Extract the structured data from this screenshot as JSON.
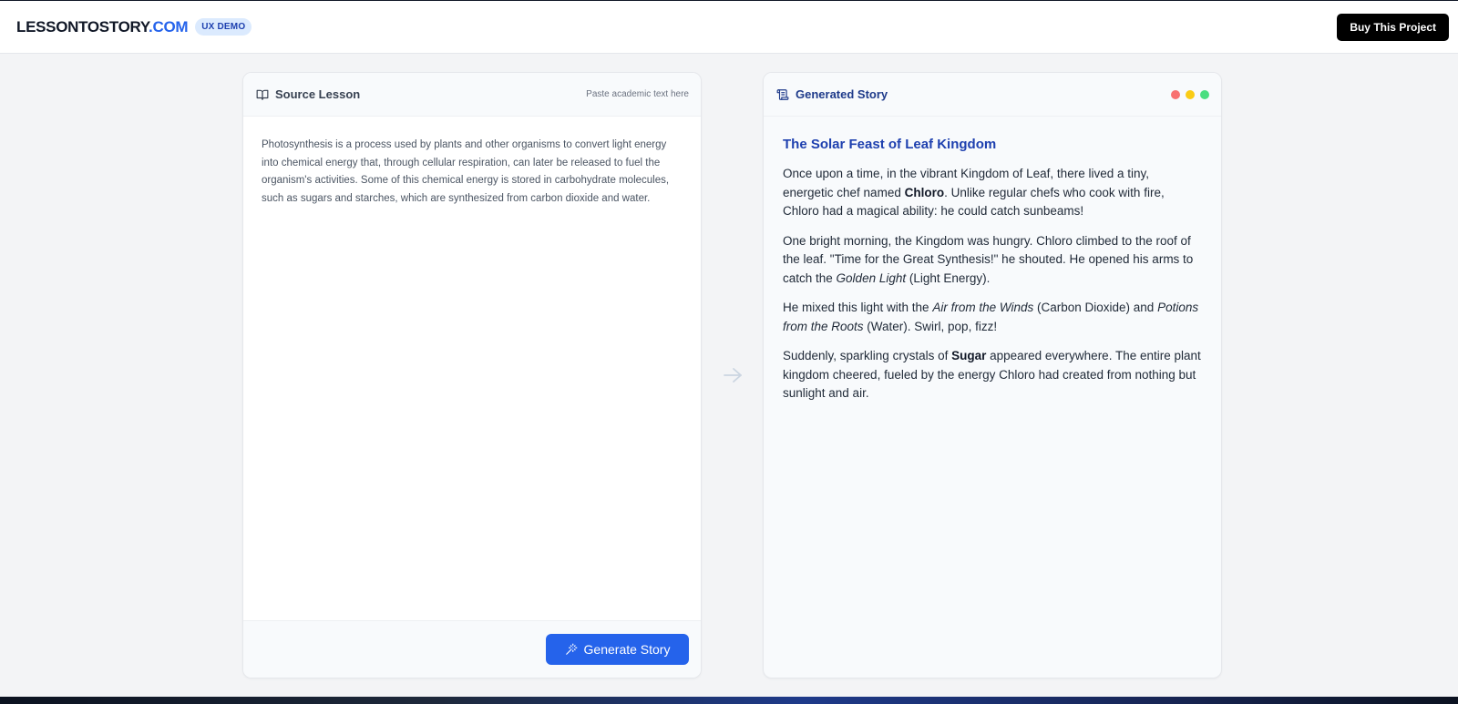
{
  "navbar": {
    "logo_main": "LESSONTOSTORY",
    "logo_accent": ".COM",
    "badge": "UX DEMO",
    "buy_label": "Buy This Project"
  },
  "source_panel": {
    "title": "Source Lesson",
    "hint": "Paste academic text here",
    "lesson_text": "Photosynthesis is a process used by plants and other organisms to convert light energy into chemical energy that, through cellular respiration, can later be released to fuel the organism's activities. Some of this chemical energy is stored in carbohydrate molecules, such as sugars and starches, which are synthesized from carbon dioxide and water.",
    "generate_label": "Generate Story"
  },
  "story_panel": {
    "title": "Generated Story",
    "window_dots": [
      "#f87171",
      "#facc15",
      "#4ade80"
    ],
    "story_title": "The Solar Feast of Leaf Kingdom",
    "p1": {
      "a": "Once upon a time, in the vibrant Kingdom of Leaf, there lived a tiny, energetic chef named ",
      "b": "Chloro",
      "c": ". Unlike regular chefs who cook with fire, Chloro had a magical ability: he could catch sunbeams!"
    },
    "p2": {
      "a": "One bright morning, the Kingdom was hungry. Chloro climbed to the roof of the leaf. \"Time for the Great Synthesis!\" he shouted. He opened his arms to catch the ",
      "b": "Golden Light",
      "c": " (Light Energy)."
    },
    "p3": {
      "a": "He mixed this light with the ",
      "b": "Air from the Winds",
      "c": " (Carbon Dioxide) and ",
      "d": "Potions from the Roots",
      "e": " (Water). Swirl, pop, fizz!"
    },
    "p4": {
      "a": "Suddenly, sparkling crystals of ",
      "b": "Sugar",
      "c": " appeared everywhere. The entire plant kingdom cheered, fueled by the energy Chloro had created from nothing but sunlight and air."
    }
  },
  "colors": {
    "accent": "#2563eb",
    "title_blue": "#1e40af"
  },
  "icons": {
    "source": "book-open-icon",
    "story": "scroll-icon",
    "generate": "magic-wand-icon",
    "arrow": "arrow-right-icon"
  }
}
